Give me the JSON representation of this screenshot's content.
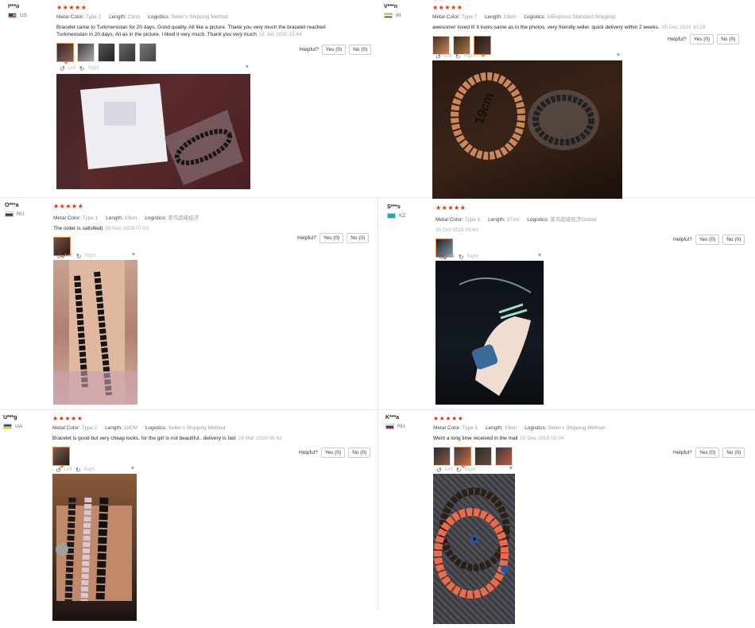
{
  "common": {
    "stars": "★★★★★",
    "helpful_label": "Helpful?",
    "metal_label": "Metal Color:",
    "length_label": "Length:",
    "logistics_label": "Logistics:",
    "left_label": "Left",
    "right_label": "Right",
    "close_glyph": "×",
    "rotate_left_glyph": "↺",
    "rotate_right_glyph": "↻"
  },
  "reviews": [
    {
      "user": "I***o",
      "country": "US",
      "metal": "Type 1",
      "length": "23cm",
      "logistics": "Seller's Shipping Method",
      "text": "Bracelet came to Turkmenistan for 20 days. Good quality. All like a picture. Thank you very much the bracelet reached Turkmenistan in 20 days. All as in the picture. I liked it very much. Thank you very much",
      "date": "18 Jan 2020 13:44",
      "yes": "Yes (0)",
      "no": "No (0)"
    },
    {
      "user": "V***n",
      "country": "IN",
      "metal": "Type 7",
      "length": "19cm",
      "logistics": "AliExpress Standard Shipping",
      "text": "awesome! loved it! it looks same as in the photos. very friendly seller. quick delivery within 2 weeks.",
      "date": "05 Dec 2019 10:29",
      "yes": "Yes (0)",
      "no": "No (0)"
    },
    {
      "user": "O***a",
      "country": "RU",
      "metal": "Type 1",
      "length": "19cm",
      "logistics": "菜鸟超级经济",
      "text": "The order is satisfied)",
      "date": "09 Nov 2019 07:02",
      "yes": "Yes (0)",
      "no": "No (0)"
    },
    {
      "user": "S***s",
      "country": "KZ",
      "metal": "Type 1",
      "length": "17cm",
      "logistics": "菜鸟超级经济Global",
      "text": "",
      "date": "30 Oct 2019 03:43",
      "yes": "Yes (0)",
      "no": "No (0)"
    },
    {
      "user": "U***g",
      "country": "UA",
      "metal": "Type 2",
      "length": "19CM",
      "logistics": "Seller's Shipping Method",
      "text": "Bracelet is good but very cheap looks. for the girl is not beautiful.. delivery is fast",
      "date": "28 Mar 2020 06:43",
      "yes": "Yes (0)",
      "no": "No (0)"
    },
    {
      "user": "K***a",
      "country": "RU",
      "metal": "Type 1",
      "length": "19cm",
      "logistics": "Seller's Shipping Method",
      "text": "Went a long time received in the mail",
      "date": "02 Dec 2019 06:04",
      "yes": "Yes (0)",
      "no": "No (0)"
    }
  ]
}
